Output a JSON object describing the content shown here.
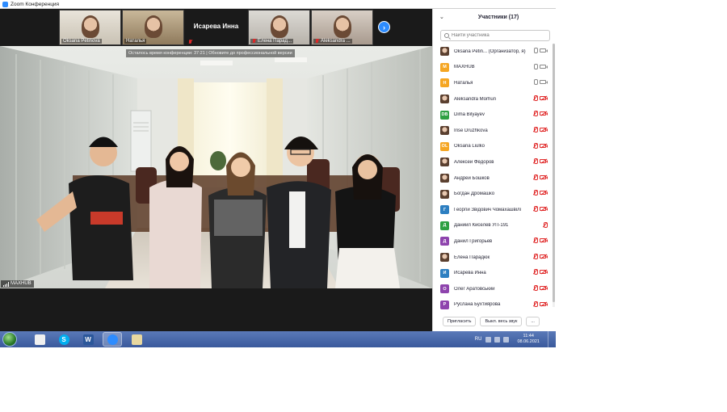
{
  "window": {
    "title": "Zoom Конференция"
  },
  "thumbnails": [
    {
      "name": "Oksana Petinova",
      "muted": false
    },
    {
      "name": "Наталья",
      "muted": false
    },
    {
      "name": "Исарева Инна",
      "muted": true,
      "video": false
    },
    {
      "name": "Елена Парад...",
      "muted": true
    },
    {
      "name": "Aleksandra ...",
      "muted": true
    }
  ],
  "main_video": {
    "notice": "Осталось время конференции: 37:21 | Обновите до профессиональной версии",
    "speaker": "MAXHUB"
  },
  "panel": {
    "title": "Участники (17)",
    "search_placeholder": "Найти участника",
    "participants": [
      {
        "name": "Oksana Petin...  (Организатор, я)",
        "initials": "",
        "color": "",
        "photo": true,
        "mic_muted": false,
        "cam_off": false
      },
      {
        "name": "MAXHUB",
        "initials": "M",
        "color": "#f5a623",
        "photo": false,
        "mic_muted": false,
        "cam_off": false
      },
      {
        "name": "Наталья",
        "initials": "Н",
        "color": "#f5a623",
        "photo": false,
        "mic_muted": false,
        "cam_off": false
      },
      {
        "name": "Aleksandra Morhun",
        "initials": "",
        "color": "",
        "photo": true,
        "mic_muted": true,
        "cam_off": true
      },
      {
        "name": "Dima Bilyayev",
        "initials": "DB",
        "color": "#2ea043",
        "photo": false,
        "mic_muted": true,
        "cam_off": true
      },
      {
        "name": "Irise Druzhkova",
        "initials": "",
        "color": "",
        "photo": true,
        "mic_muted": true,
        "cam_off": true
      },
      {
        "name": "Oksana Liulko",
        "initials": "OL",
        "color": "#f5a623",
        "photo": false,
        "mic_muted": true,
        "cam_off": true
      },
      {
        "name": "Алексей Фёдоров",
        "initials": "",
        "color": "",
        "photo": true,
        "mic_muted": true,
        "cam_off": true
      },
      {
        "name": "Андрей Бошков",
        "initials": "",
        "color": "",
        "photo": true,
        "mic_muted": true,
        "cam_off": true
      },
      {
        "name": "Богдан Дромашко",
        "initials": "",
        "color": "",
        "photo": true,
        "mic_muted": true,
        "cam_off": true
      },
      {
        "name": "Георгій Звідович Чомахашвілі",
        "initials": "Г",
        "color": "#2d7fc1",
        "photo": false,
        "mic_muted": true,
        "cam_off": true
      },
      {
        "name": "Даниил Киселев УП-191",
        "initials": "Д",
        "color": "#2ea043",
        "photo": false,
        "mic_muted": true,
        "cam_off": false
      },
      {
        "name": "Данил Григорьев",
        "initials": "Д",
        "color": "#8e44ad",
        "photo": false,
        "mic_muted": true,
        "cam_off": true
      },
      {
        "name": "Елена Парадюк",
        "initials": "",
        "color": "",
        "photo": true,
        "mic_muted": true,
        "cam_off": true
      },
      {
        "name": "Исарева Инна",
        "initials": "И",
        "color": "#2d7fc1",
        "photo": false,
        "mic_muted": true,
        "cam_off": true
      },
      {
        "name": "Олег Аратовський",
        "initials": "О",
        "color": "#8e44ad",
        "photo": false,
        "mic_muted": true,
        "cam_off": true
      },
      {
        "name": "Руслана Бухтиярова",
        "initials": "Р",
        "color": "#8e44ad",
        "photo": false,
        "mic_muted": true,
        "cam_off": true
      }
    ],
    "footer": {
      "invite": "Пригласить",
      "mute_all": "Выкл. весь звук",
      "more": "..."
    }
  },
  "taskbar": {
    "apps": [
      {
        "name": "file-explorer-icon",
        "glyph": "",
        "color": "#f0f0f0"
      },
      {
        "name": "skype-icon",
        "glyph": "S",
        "color": "#00aff0"
      },
      {
        "name": "word-icon",
        "glyph": "W",
        "color": "#2b579a"
      },
      {
        "name": "zoom-icon",
        "glyph": "",
        "color": "#2d8cff"
      },
      {
        "name": "paint-icon",
        "glyph": "",
        "color": "#e8d8a0"
      }
    ],
    "lang": "RU",
    "time": "11:44",
    "date": "08.06.2021"
  }
}
